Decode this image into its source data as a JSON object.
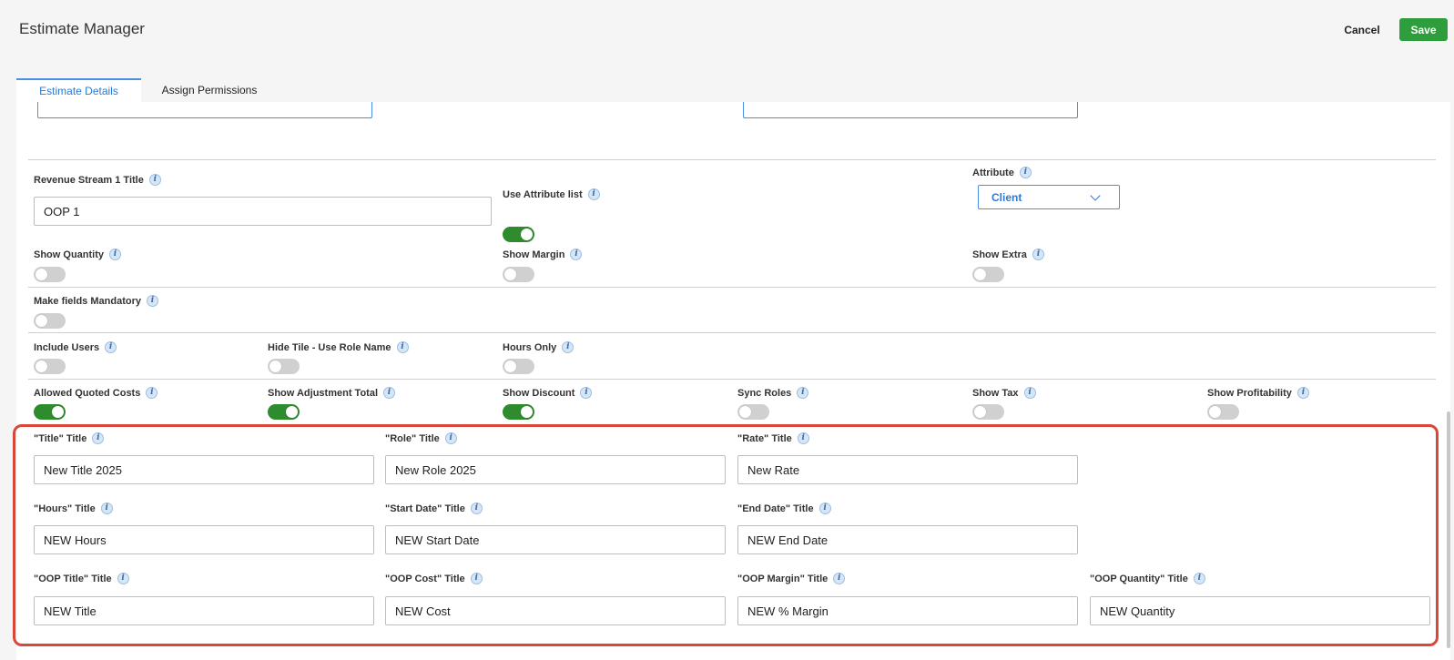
{
  "header": {
    "title": "Estimate Manager",
    "cancel_label": "Cancel",
    "save_label": "Save"
  },
  "tabs": [
    {
      "label": "Estimate Details",
      "active": true
    },
    {
      "label": "Assign Permissions",
      "active": false
    }
  ],
  "revenue_stream": {
    "title_label": "Revenue Stream 1 Title",
    "title_value": "OOP 1"
  },
  "use_attribute_list": {
    "label": "Use Attribute list",
    "on": true
  },
  "attribute": {
    "label": "Attribute",
    "selected": "Client"
  },
  "toggles": {
    "show_quantity": {
      "label": "Show Quantity",
      "on": false
    },
    "show_margin": {
      "label": "Show Margin",
      "on": false
    },
    "show_extra": {
      "label": "Show Extra",
      "on": false
    },
    "make_fields_mandatory": {
      "label": "Make fields Mandatory",
      "on": false
    },
    "include_users": {
      "label": "Include Users",
      "on": false
    },
    "hide_tile_use_role_name": {
      "label": "Hide Tile - Use Role Name",
      "on": false
    },
    "hours_only": {
      "label": "Hours Only",
      "on": false
    },
    "allowed_quoted_costs": {
      "label": "Allowed Quoted Costs",
      "on": true
    },
    "show_adjustment_total": {
      "label": "Show Adjustment Total",
      "on": true
    },
    "show_discount": {
      "label": "Show Discount",
      "on": true
    },
    "sync_roles": {
      "label": "Sync Roles",
      "on": false
    },
    "show_tax": {
      "label": "Show Tax",
      "on": false
    },
    "show_profitability": {
      "label": "Show Profitability",
      "on": false
    }
  },
  "title_fields": {
    "title": {
      "label": "\"Title\" Title",
      "value": "New Title 2025"
    },
    "role": {
      "label": "\"Role\" Title",
      "value": "New Role 2025"
    },
    "rate": {
      "label": "\"Rate\" Title",
      "value": "New Rate"
    },
    "hours": {
      "label": "\"Hours\" Title",
      "value": "NEW Hours"
    },
    "start_date": {
      "label": "\"Start Date\" Title",
      "value": "NEW Start Date"
    },
    "end_date": {
      "label": "\"End Date\" Title",
      "value": "NEW End Date"
    },
    "oop_title": {
      "label": "\"OOP Title\" Title",
      "value": "NEW Title"
    },
    "oop_cost": {
      "label": "\"OOP Cost\" Title",
      "value": "NEW Cost"
    },
    "oop_margin": {
      "label": "\"OOP Margin\" Title",
      "value": "NEW % Margin"
    },
    "oop_quantity": {
      "label": "\"OOP Quantity\" Title",
      "value": "NEW Quantity"
    }
  },
  "colors": {
    "save": "#2e9e3c",
    "toggle_on": "#2e8b2e",
    "accent": "#4a90e2",
    "highlight": "#d9473b"
  }
}
